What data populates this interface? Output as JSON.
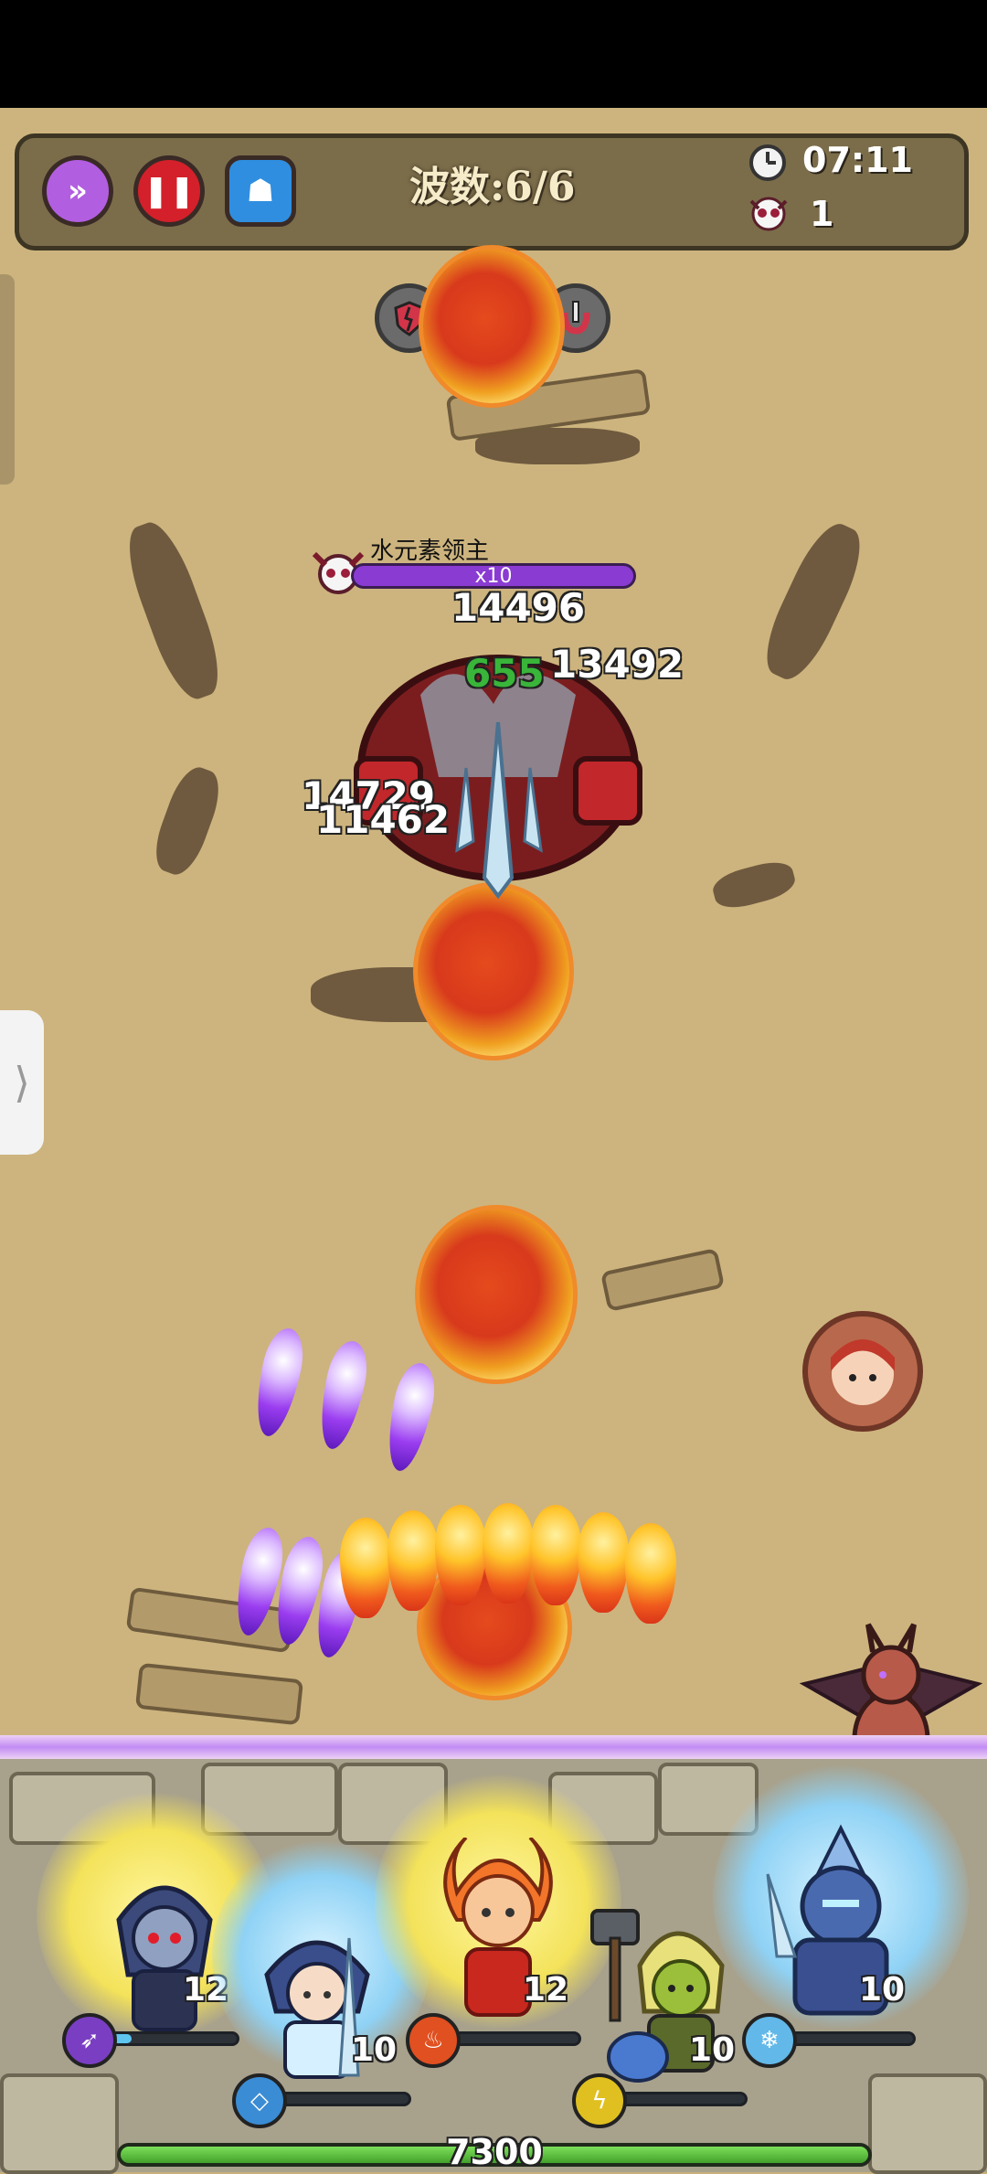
{
  "hud": {
    "wave_label": "波数:6/6",
    "timer": "07:11",
    "kills": "1",
    "buttons": [
      {
        "name": "speed-up",
        "color": "#b25ee0",
        "icon": "fast-forward-icon"
      },
      {
        "name": "pause",
        "color": "#d4202a",
        "icon": "pause-icon"
      },
      {
        "name": "character",
        "color": "#2f8ee0",
        "icon": "hooded-figure-icon"
      }
    ],
    "buffs": [
      "broken-shield-icon",
      "heart-plus-icon",
      "sword-magnet-icon"
    ]
  },
  "boss": {
    "name": "水元素领主",
    "multiplier": "x10",
    "health_fraction": 1.0,
    "bar_color": "#8a3bd2"
  },
  "damage_numbers": [
    {
      "text": "14496",
      "kind": "damage"
    },
    {
      "text": "655",
      "kind": "heal"
    },
    {
      "text": "13492",
      "kind": "damage"
    },
    {
      "text": "14729",
      "kind": "damage"
    },
    {
      "text": "11462",
      "kind": "damage"
    }
  ],
  "heroes": [
    {
      "name": "dark-knight",
      "level": "12",
      "skill_icon": "spear-icon",
      "skill_color": "#7a3ec2",
      "mana_fraction": 0.12
    },
    {
      "name": "ice-mage",
      "level": "10",
      "skill_icon": "ice-crystal-icon",
      "skill_color": "#3a8cd4",
      "mana_fraction": 0.0
    },
    {
      "name": "fire-monkey",
      "level": "12",
      "skill_icon": "fire-icon",
      "skill_color": "#e05020",
      "mana_fraction": 0.0
    },
    {
      "name": "hammer-goblin",
      "level": "10",
      "skill_icon": "lightning-icon",
      "skill_color": "#e0c020",
      "mana_fraction": 0.0
    },
    {
      "name": "frost-knight",
      "level": "10",
      "skill_icon": "frost-icon",
      "skill_color": "#62b8e8",
      "mana_fraction": 0.0
    }
  ],
  "base_hp": "7300",
  "side_handle_icon": "chevron-right-icon"
}
